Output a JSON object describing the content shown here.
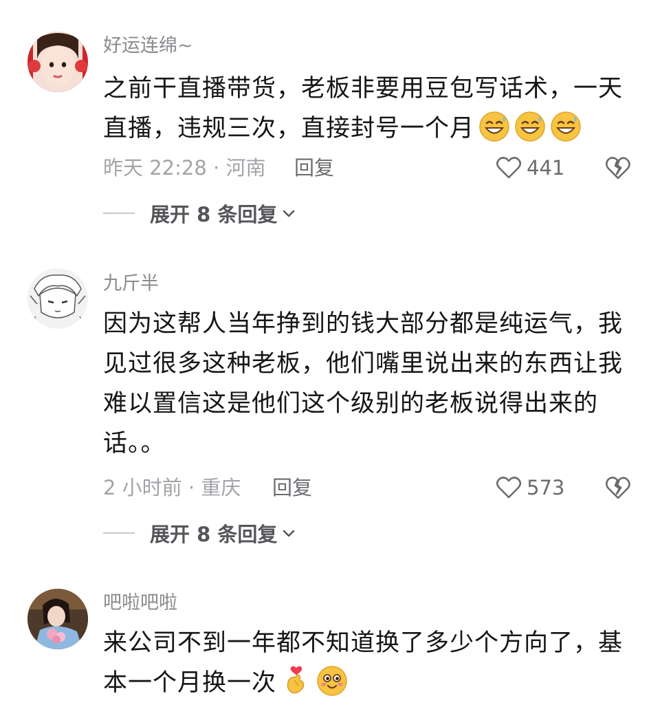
{
  "comments": [
    {
      "username": "好运连绵~",
      "lines": [
        "之前干直播带货，老板非要用豆包写话术，一天",
        "直播，违规三次，直接封号一个月"
      ],
      "emojis": [
        "grinning-sweat-emoji",
        "grinning-sweat-emoji",
        "grinning-sweat-emoji"
      ],
      "time": "昨天 22:28 · 河南",
      "reply_label": "回复",
      "likes": "441",
      "expand_label": "展开 8 条回复"
    },
    {
      "username": "九斤半",
      "lines": [
        "因为这帮人当年挣到的钱大部分都是纯运气，我",
        "见过很多这种老板，他们嘴里说出来的东西让我",
        "难以置信这是他们这个级别的老板说得出来的",
        "话。。"
      ],
      "time": "2 小时前 · 重庆",
      "reply_label": "回复",
      "likes": "573",
      "expand_label": "展开 8 条回复"
    },
    {
      "username": "吧啦吧啦",
      "lines": [
        "来公司不到一年都不知道换了多少个方向了，基",
        "本一个月换一次"
      ],
      "emojis": [
        "finger-heart-emoji",
        "blushing-smile-emoji"
      ]
    }
  ],
  "colors": {
    "text": "#161616",
    "username": "#8a8a8f",
    "meta": "#a3a3a8",
    "action": "#6b6b70",
    "emoji": "#f6c342"
  }
}
